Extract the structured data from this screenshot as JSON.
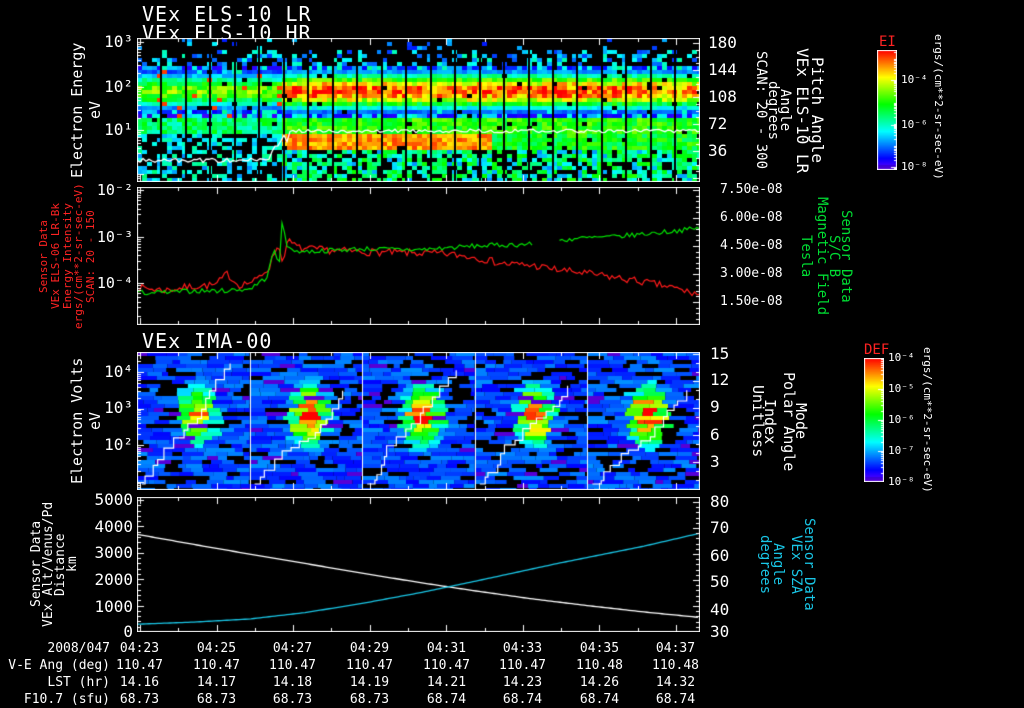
{
  "titles": {
    "els_lr": "VEx ELS-10 LR",
    "els_hr": "VEx ELS-10 HR",
    "ima": "VEx IMA-00"
  },
  "panel1": {
    "left_ticks": [
      "10³",
      "10²",
      "10¹"
    ],
    "left_labels": [
      "Electron Energy",
      "eV"
    ],
    "right_ticks": [
      "180",
      "144",
      "108",
      "72",
      "36"
    ],
    "right_labels": [
      "Pitch Angle",
      "VEx ELS-10 LR",
      "Angle",
      "degrees",
      "SCAN: 20 - 300"
    ]
  },
  "colorbar1": {
    "title": "EI",
    "units": "ergs/(cm**2-sr-sec-eV)",
    "ticks": [
      "10⁻⁴",
      "10⁻⁶",
      "10⁻⁸"
    ]
  },
  "panel2": {
    "left_ticks": [
      "10⁻²",
      "10⁻³",
      "10⁻⁴"
    ],
    "left_labels": [
      "Sensor Data",
      "VEx ELS-06 LR-Bk",
      "Energy Intensity",
      "ergs/(cm**2-sr-sec-eV)",
      "SCAN: 20 - 150"
    ],
    "right_ticks": [
      "7.50e-08",
      "6.00e-08",
      "4.50e-08",
      "3.00e-08",
      "1.50e-08"
    ],
    "right_labels": [
      "Sensor Data",
      "S/C B",
      "Magnetic Field",
      "Tesla"
    ]
  },
  "panel3": {
    "left_ticks": [
      "10⁴",
      "10³",
      "10²"
    ],
    "left_labels": [
      "Electron Volts",
      "eV"
    ],
    "right_ticks": [
      "15",
      "12",
      "9",
      "6",
      "3"
    ],
    "right_labels": [
      "Mode",
      "Polar Angle",
      "Index",
      "Unitless"
    ]
  },
  "colorbar2": {
    "title": "DEF",
    "units": "ergs/(cm**2-sr-sec-eV)",
    "ticks": [
      "10⁻⁴",
      "10⁻⁵",
      "10⁻⁶",
      "10⁻⁷",
      "10⁻⁸"
    ]
  },
  "panel4": {
    "left_ticks": [
      "5000",
      "4000",
      "3000",
      "2000",
      "1000",
      "0"
    ],
    "left_labels": [
      "Sensor Data",
      "VEx Alt/Venus/Pd",
      "Distance",
      "km"
    ],
    "right_ticks": [
      "80",
      "70",
      "60",
      "50",
      "40",
      "30"
    ],
    "right_labels": [
      "Sensor Data",
      "VEx SZA",
      "Angle",
      "degrees"
    ]
  },
  "table": {
    "rows": [
      {
        "label": "2008/047",
        "values": [
          "04:23",
          "04:25",
          "04:27",
          "04:29",
          "04:31",
          "04:33",
          "04:35",
          "04:37"
        ]
      },
      {
        "label": "V-E Ang (deg)",
        "values": [
          "110.47",
          "110.47",
          "110.47",
          "110.47",
          "110.47",
          "110.47",
          "110.48",
          "110.48"
        ]
      },
      {
        "label": "LST (hr)",
        "values": [
          "14.16",
          "14.17",
          "14.18",
          "14.19",
          "14.21",
          "14.23",
          "14.26",
          "14.32"
        ]
      },
      {
        "label": "F10.7 (sfu)",
        "values": [
          "68.73",
          "68.73",
          "68.73",
          "68.73",
          "68.74",
          "68.74",
          "68.74",
          "68.74"
        ]
      }
    ]
  },
  "chart_data": [
    {
      "type": "heatmap",
      "title": "VEx ELS-10 LR / VEx ELS-10 HR electron energy spectrogram",
      "x_start": "04:23",
      "x_end": "04:38",
      "ylabel": "Electron Energy (eV)",
      "y_scale": "log",
      "y_range_eV": [
        1,
        2000
      ],
      "right_axis": {
        "label": "Pitch Angle VEx ELS-10 LR (degrees), SCAN: 20 - 300",
        "ticks": [
          180,
          144,
          108,
          72,
          36
        ]
      },
      "colorbar": {
        "label": "EI",
        "units": "ergs/(cm**2-sr-sec-eV)",
        "ticks": [
          0.0001,
          1e-06,
          1e-08
        ]
      },
      "features": "intense 20-300 eV flux band (red) begins ~04:27 shock crossing; ~23 vertical scan gaps; white pitch-angle trace steps up from 85% to 64% panel height at ~04:27"
    },
    {
      "type": "line",
      "x_start": "04:23",
      "x_end": "04:38",
      "left_axis": {
        "label": "VEx ELS-06 LR-Bk Energy Intensity, ergs/(cm**2-sr-sec-eV), SCAN: 20 - 150",
        "scale": "log",
        "range": [
          1e-05,
          0.01
        ]
      },
      "right_axis": {
        "label": "S/C B Magnetic Field (Tesla)",
        "scale": "linear",
        "range": [
          0,
          7.65e-08
        ]
      },
      "series": [
        {
          "name": "energy-intensity",
          "color": "#ff1a1a",
          "axis": "left",
          "points": [
            [
              0.0,
              8e-05
            ],
            [
              0.05,
              7e-05
            ],
            [
              0.1,
              8.5e-05
            ],
            [
              0.14,
              9e-05
            ],
            [
              0.16,
              0.00016
            ],
            [
              0.18,
              9e-05
            ],
            [
              0.21,
              0.00011
            ],
            [
              0.235,
              0.00022
            ],
            [
              0.25,
              0.0007
            ],
            [
              0.258,
              0.0003
            ],
            [
              0.268,
              0.0008
            ],
            [
              0.29,
              0.00055
            ],
            [
              0.35,
              0.0005
            ],
            [
              0.42,
              0.00046
            ],
            [
              0.5,
              0.00044
            ],
            [
              0.55,
              0.00042
            ],
            [
              0.6,
              0.00036
            ],
            [
              0.65,
              0.00026
            ],
            [
              0.7,
              0.00024
            ],
            [
              0.75,
              0.00019
            ],
            [
              0.8,
              0.00016
            ],
            [
              0.85,
              0.00013
            ],
            [
              0.9,
              0.000105
            ],
            [
              0.95,
              8e-05
            ],
            [
              1.0,
              5.5e-05
            ]
          ]
        },
        {
          "name": "magnetic-field",
          "color": "#00e000",
          "axis": "right",
          "gap_u": [
            0.705,
            0.748
          ],
          "points": [
            [
              0.0,
              2e-08
            ],
            [
              0.05,
              2e-08
            ],
            [
              0.1,
              2.1e-08
            ],
            [
              0.15,
              2.1e-08
            ],
            [
              0.2,
              2.2e-08
            ],
            [
              0.23,
              2.8e-08
            ],
            [
              0.245,
              4.4e-08
            ],
            [
              0.252,
              3.1e-08
            ],
            [
              0.258,
              6e-08
            ],
            [
              0.268,
              4.3e-08
            ],
            [
              0.3,
              4.2e-08
            ],
            [
              0.4,
              4.35e-08
            ],
            [
              0.5,
              4.3e-08
            ],
            [
              0.6,
              4.5e-08
            ],
            [
              0.7,
              4.6e-08
            ],
            [
              0.78,
              4.9e-08
            ],
            [
              0.85,
              5e-08
            ],
            [
              0.92,
              5.2e-08
            ],
            [
              1.0,
              5.45e-08
            ]
          ]
        }
      ]
    },
    {
      "type": "heatmap",
      "title": "VEx IMA-00 ion spectrogram",
      "x_start": "04:23",
      "x_end": "04:38",
      "ylabel": "Electron Volts (eV)",
      "y_scale": "log",
      "y_range_eV": [
        6,
        30000
      ],
      "right_axis": {
        "label": "Mode / Polar Angle Index (Unitless)",
        "ticks": [
          15,
          12,
          9,
          6,
          3
        ]
      },
      "colorbar": {
        "label": "DEF",
        "units": "ergs/(cm**2-sr-sec-eV)",
        "ticks": [
          0.0001,
          1e-05,
          1e-06,
          1e-07,
          1e-08
        ]
      },
      "features": "five mass-analyzer sweep segments separated by white lines; red flux core near 1 keV in each; white stair-step polar-angle trace rises across each segment"
    },
    {
      "type": "line",
      "x_start": "04:23",
      "x_end": "04:38",
      "left_axis": {
        "label": "VEx Alt/Venus/Pd Distance (km)",
        "scale": "linear",
        "range": [
          0,
          5000
        ]
      },
      "right_axis": {
        "label": "VEx SZA Angle (degrees)",
        "scale": "linear",
        "range": [
          30,
          80
        ]
      },
      "series": [
        {
          "name": "altitude",
          "color": "#ffffff",
          "axis": "left",
          "points": [
            [
              0,
              3700
            ],
            [
              0.1,
              3320
            ],
            [
              0.2,
              2950
            ],
            [
              0.3,
              2590
            ],
            [
              0.4,
              2230
            ],
            [
              0.5,
              1880
            ],
            [
              0.6,
              1560
            ],
            [
              0.7,
              1260
            ],
            [
              0.8,
              1000
            ],
            [
              0.9,
              760
            ],
            [
              1,
              550
            ]
          ]
        },
        {
          "name": "solar-zenith-angle",
          "color": "#19c6e6",
          "axis": "right",
          "points": [
            [
              0,
              33
            ],
            [
              0.1,
              33.8
            ],
            [
              0.2,
              35
            ],
            [
              0.3,
              37.5
            ],
            [
              0.4,
              41
            ],
            [
              0.5,
              45
            ],
            [
              0.6,
              49.5
            ],
            [
              0.75,
              56.5
            ],
            [
              0.9,
              63
            ],
            [
              1,
              68
            ]
          ]
        }
      ]
    }
  ]
}
